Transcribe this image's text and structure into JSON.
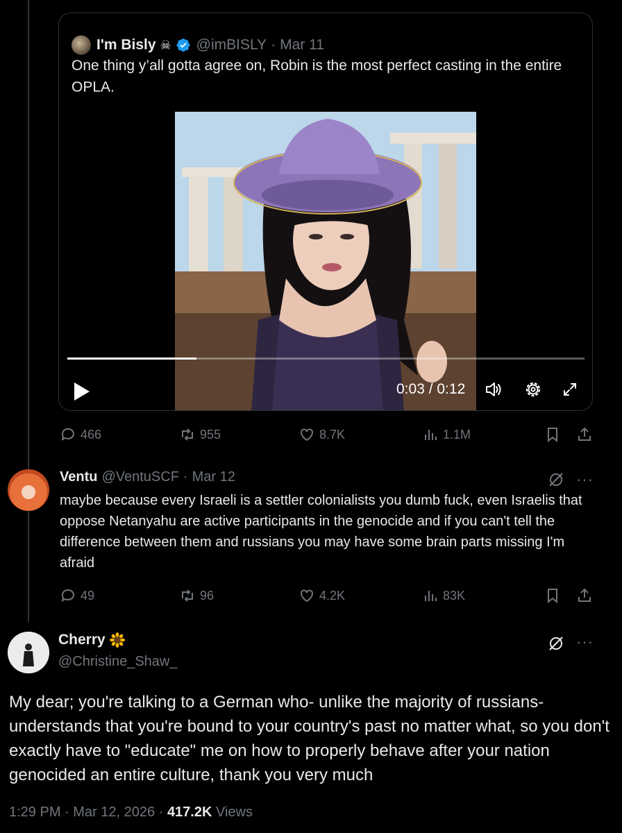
{
  "quoted_tweet": {
    "display_name": "I'm Bisly",
    "name_emoji": "☠",
    "handle": "@imBISLY",
    "separator": "·",
    "date": "Mar 11",
    "text": "One thing y’all gotta agree on, Robin is the most perfect casting in the entire OPLA.",
    "video": {
      "current_time": "0:03",
      "duration": "0:12",
      "time_display": "0:03 / 0:12",
      "progress_fraction": 0.25
    }
  },
  "parent_actions": {
    "replies": "466",
    "reposts": "955",
    "likes": "8.7K",
    "views": "1.1M"
  },
  "reply": {
    "display_name": "Ventu",
    "handle": "@VentuSCF",
    "separator": "·",
    "date": "Mar 12",
    "text": "maybe because every Israeli is a settler colonialists you dumb fuck, even Israelis that oppose Netanyahu are active participants in the genocide and if you can't tell the difference between them and russians you may have some brain parts missing I'm afraid",
    "actions": {
      "replies": "49",
      "reposts": "96",
      "likes": "4.2K",
      "views": "83K"
    }
  },
  "main_tweet": {
    "display_name": "Cherry",
    "name_emoji": "🌻",
    "handle": "@Christine_Shaw_",
    "text": "My dear; you're talking to a German who- unlike the majority of russians- understands that you're bound to your country's past no matter what, so you don't exactly have to \"educate\" me on how to properly behave after your nation genocided an entire culture, thank you very much",
    "time": "1:29 PM",
    "separator": "·",
    "date": "Mar 12, 2026",
    "views_count": "417.2K",
    "views_label": "Views"
  },
  "colors": {
    "background": "#000000",
    "text": "#e7e9ea",
    "muted": "#71767b",
    "border": "#2f3336",
    "verified": "#1d9bf0"
  }
}
